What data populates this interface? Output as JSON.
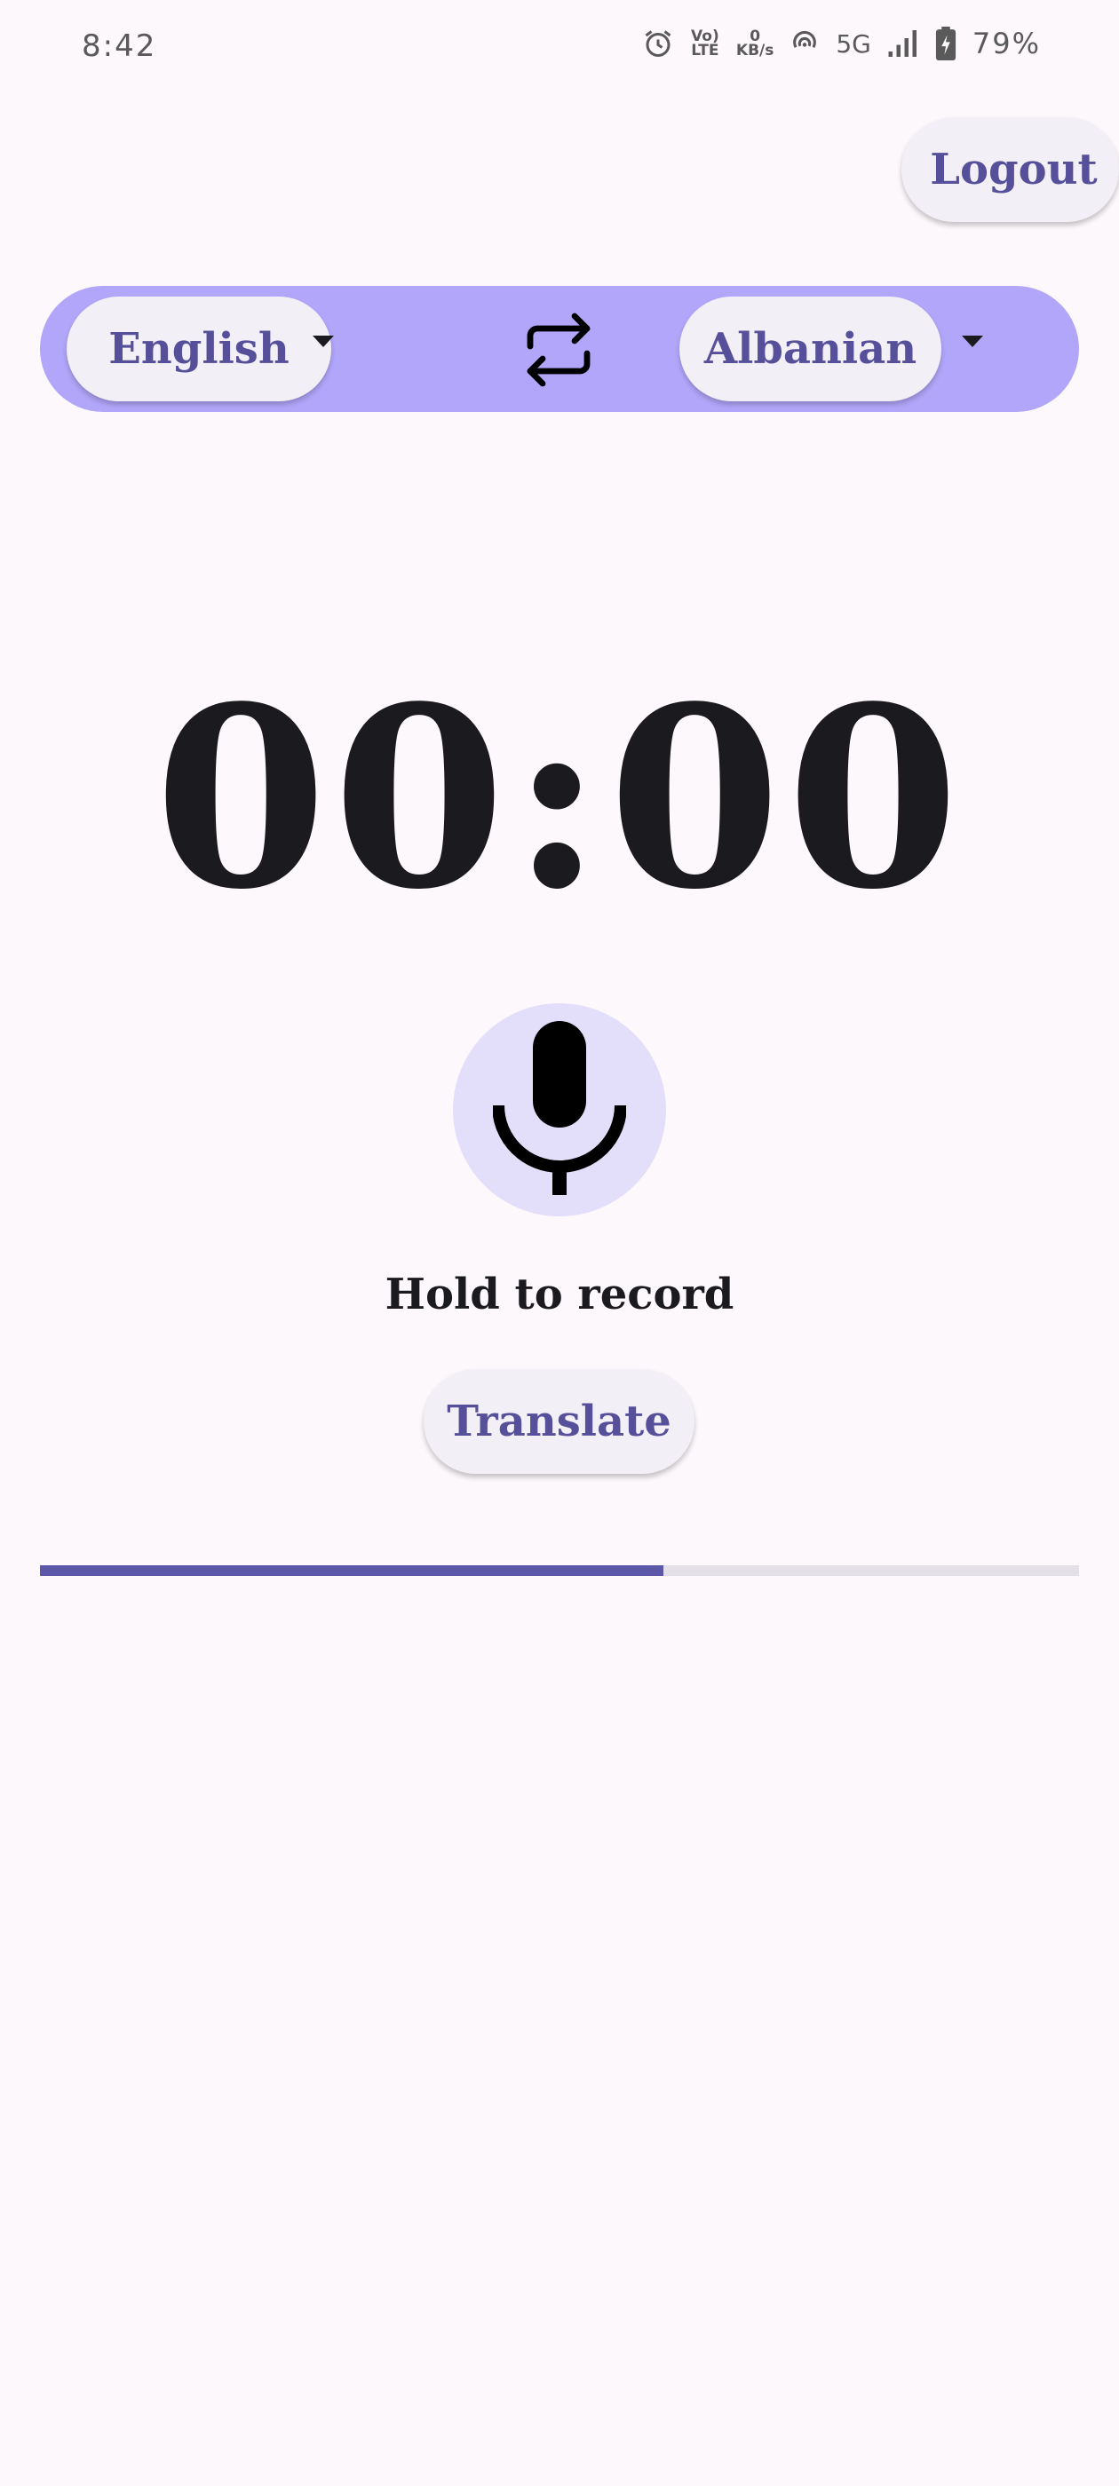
{
  "status_bar": {
    "time": "8:42",
    "volte_label": "Vo) LTE",
    "data_speed_value": "0",
    "data_speed_unit": "KB/s",
    "network": "5G",
    "battery": "79%"
  },
  "header": {
    "logout_label": "Logout"
  },
  "language_bar": {
    "source_language": "English",
    "target_language": "Albanian"
  },
  "recorder": {
    "timer": "00:00",
    "hold_label": "Hold to record",
    "translate_label": "Translate"
  },
  "progress": {
    "percent": 60
  },
  "colors": {
    "accent": "#56509a",
    "language_bar": "#b2a6fa",
    "mic_bg": "#e3dffb",
    "progress_fill": "#5c57a8",
    "background": "#fdf8fc"
  }
}
